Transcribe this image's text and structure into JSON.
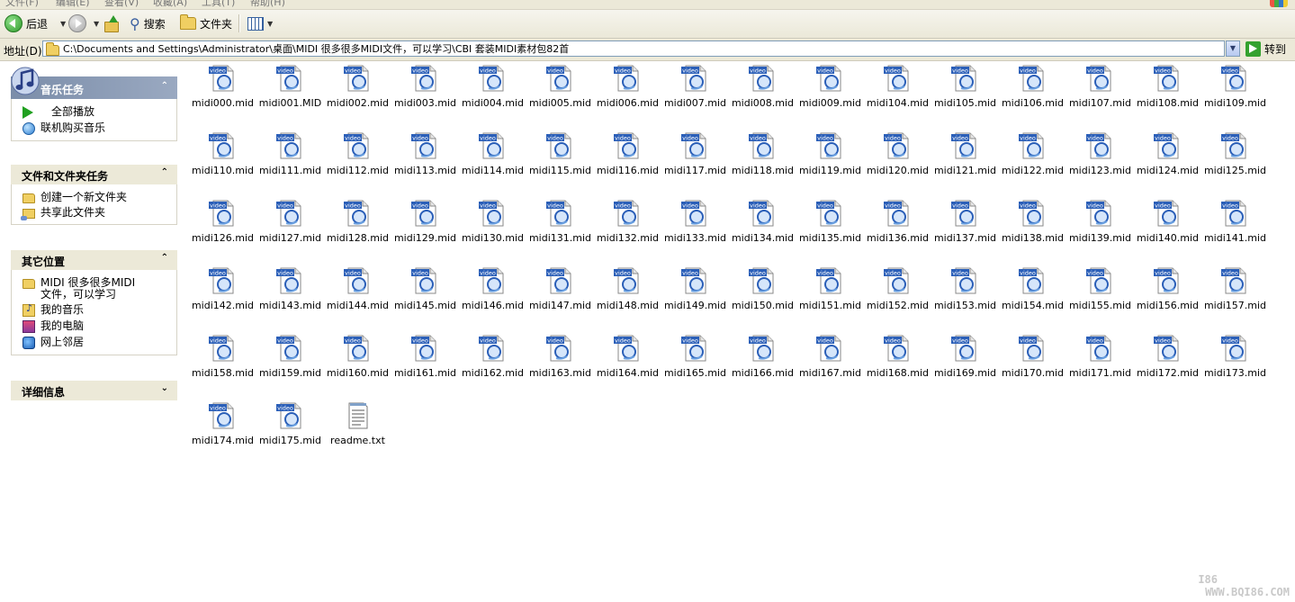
{
  "menubar": {
    "items": [
      "文件(F)",
      "编辑(E)",
      "查看(V)",
      "收藏(A)",
      "工具(T)",
      "帮助(H)"
    ]
  },
  "toolbar": {
    "back_label": "后退",
    "search_label": "搜索",
    "folders_label": "文件夹"
  },
  "address": {
    "label": "地址(D)",
    "path": "C:\\Documents and Settings\\Administrator\\桌面\\MIDI 很多很多MIDI文件，可以学习\\CBI 套装MIDI素材包82首",
    "go_label": "转到"
  },
  "taskpane": {
    "music_tasks": {
      "title": "音乐任务",
      "items": [
        "全部播放",
        "联机购买音乐"
      ]
    },
    "file_tasks": {
      "title": "文件和文件夹任务",
      "items": [
        "创建一个新文件夹",
        "共享此文件夹"
      ]
    },
    "other_places": {
      "title": "其它位置",
      "items": [
        "MIDI 很多很多MIDI文件，可以学习",
        "我的音乐",
        "我的电脑",
        "网上邻居"
      ]
    },
    "details": {
      "title": "详细信息"
    }
  },
  "icons": {
    "midi_badge_text": "video",
    "midi_icon": "video-file-icon",
    "txt_icon": "text-file-icon"
  },
  "files": [
    {
      "name": "midi000.mid",
      "type": "midi"
    },
    {
      "name": "midi001.MID",
      "type": "midi"
    },
    {
      "name": "midi002.mid",
      "type": "midi"
    },
    {
      "name": "midi003.mid",
      "type": "midi"
    },
    {
      "name": "midi004.mid",
      "type": "midi"
    },
    {
      "name": "midi005.mid",
      "type": "midi"
    },
    {
      "name": "midi006.mid",
      "type": "midi"
    },
    {
      "name": "midi007.mid",
      "type": "midi"
    },
    {
      "name": "midi008.mid",
      "type": "midi"
    },
    {
      "name": "midi009.mid",
      "type": "midi"
    },
    {
      "name": "midi104.mid",
      "type": "midi"
    },
    {
      "name": "midi105.mid",
      "type": "midi"
    },
    {
      "name": "midi106.mid",
      "type": "midi"
    },
    {
      "name": "midi107.mid",
      "type": "midi"
    },
    {
      "name": "midi108.mid",
      "type": "midi"
    },
    {
      "name": "midi109.mid",
      "type": "midi"
    },
    {
      "name": "midi110.mid",
      "type": "midi"
    },
    {
      "name": "midi111.mid",
      "type": "midi"
    },
    {
      "name": "midi112.mid",
      "type": "midi"
    },
    {
      "name": "midi113.mid",
      "type": "midi"
    },
    {
      "name": "midi114.mid",
      "type": "midi"
    },
    {
      "name": "midi115.mid",
      "type": "midi"
    },
    {
      "name": "midi116.mid",
      "type": "midi"
    },
    {
      "name": "midi117.mid",
      "type": "midi"
    },
    {
      "name": "midi118.mid",
      "type": "midi"
    },
    {
      "name": "midi119.mid",
      "type": "midi"
    },
    {
      "name": "midi120.mid",
      "type": "midi"
    },
    {
      "name": "midi121.mid",
      "type": "midi"
    },
    {
      "name": "midi122.mid",
      "type": "midi"
    },
    {
      "name": "midi123.mid",
      "type": "midi"
    },
    {
      "name": "midi124.mid",
      "type": "midi"
    },
    {
      "name": "midi125.mid",
      "type": "midi"
    },
    {
      "name": "midi126.mid",
      "type": "midi"
    },
    {
      "name": "midi127.mid",
      "type": "midi"
    },
    {
      "name": "midi128.mid",
      "type": "midi"
    },
    {
      "name": "midi129.mid",
      "type": "midi"
    },
    {
      "name": "midi130.mid",
      "type": "midi"
    },
    {
      "name": "midi131.mid",
      "type": "midi"
    },
    {
      "name": "midi132.mid",
      "type": "midi"
    },
    {
      "name": "midi133.mid",
      "type": "midi"
    },
    {
      "name": "midi134.mid",
      "type": "midi"
    },
    {
      "name": "midi135.mid",
      "type": "midi"
    },
    {
      "name": "midi136.mid",
      "type": "midi"
    },
    {
      "name": "midi137.mid",
      "type": "midi"
    },
    {
      "name": "midi138.mid",
      "type": "midi"
    },
    {
      "name": "midi139.mid",
      "type": "midi"
    },
    {
      "name": "midi140.mid",
      "type": "midi"
    },
    {
      "name": "midi141.mid",
      "type": "midi"
    },
    {
      "name": "midi142.mid",
      "type": "midi"
    },
    {
      "name": "midi143.mid",
      "type": "midi"
    },
    {
      "name": "midi144.mid",
      "type": "midi"
    },
    {
      "name": "midi145.mid",
      "type": "midi"
    },
    {
      "name": "midi146.mid",
      "type": "midi"
    },
    {
      "name": "midi147.mid",
      "type": "midi"
    },
    {
      "name": "midi148.mid",
      "type": "midi"
    },
    {
      "name": "midi149.mid",
      "type": "midi"
    },
    {
      "name": "midi150.mid",
      "type": "midi"
    },
    {
      "name": "midi151.mid",
      "type": "midi"
    },
    {
      "name": "midi152.mid",
      "type": "midi"
    },
    {
      "name": "midi153.mid",
      "type": "midi"
    },
    {
      "name": "midi154.mid",
      "type": "midi"
    },
    {
      "name": "midi155.mid",
      "type": "midi"
    },
    {
      "name": "midi156.mid",
      "type": "midi"
    },
    {
      "name": "midi157.mid",
      "type": "midi"
    },
    {
      "name": "midi158.mid",
      "type": "midi"
    },
    {
      "name": "midi159.mid",
      "type": "midi"
    },
    {
      "name": "midi160.mid",
      "type": "midi"
    },
    {
      "name": "midi161.mid",
      "type": "midi"
    },
    {
      "name": "midi162.mid",
      "type": "midi"
    },
    {
      "name": "midi163.mid",
      "type": "midi"
    },
    {
      "name": "midi164.mid",
      "type": "midi"
    },
    {
      "name": "midi165.mid",
      "type": "midi"
    },
    {
      "name": "midi166.mid",
      "type": "midi"
    },
    {
      "name": "midi167.mid",
      "type": "midi"
    },
    {
      "name": "midi168.mid",
      "type": "midi"
    },
    {
      "name": "midi169.mid",
      "type": "midi"
    },
    {
      "name": "midi170.mid",
      "type": "midi"
    },
    {
      "name": "midi171.mid",
      "type": "midi"
    },
    {
      "name": "midi172.mid",
      "type": "midi"
    },
    {
      "name": "midi173.mid",
      "type": "midi"
    },
    {
      "name": "midi174.mid",
      "type": "midi"
    },
    {
      "name": "midi175.mid",
      "type": "midi"
    },
    {
      "name": "readme.txt",
      "type": "txt"
    }
  ],
  "watermark": {
    "line1": "I86",
    "line2": "WWW.BQI86.COM"
  },
  "colors": {
    "chrome": "#ece9d8",
    "music_header": "#7b8da9",
    "accent_green": "#2e9a2b"
  }
}
